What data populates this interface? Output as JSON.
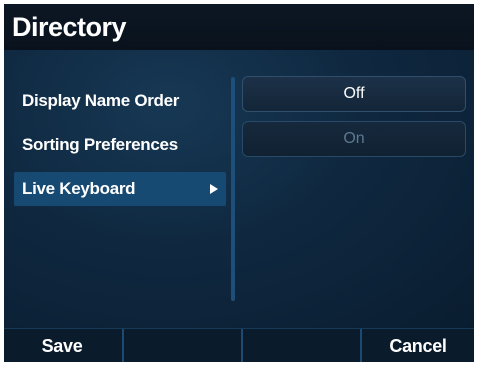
{
  "app": {
    "title": "Directory"
  },
  "menu": {
    "items": [
      {
        "label": "Display Name Order",
        "selected": false
      },
      {
        "label": "Sorting Preferences",
        "selected": false
      },
      {
        "label": "Live Keyboard",
        "selected": true
      }
    ]
  },
  "options": [
    {
      "label": "Off",
      "state": "highlighted"
    },
    {
      "label": "On",
      "state": "dimmed"
    }
  ],
  "softkeys": {
    "left": "Save",
    "slot2": "",
    "slot3": "",
    "right": "Cancel"
  },
  "colors": {
    "screen_bg": "#0b1a2a",
    "selected_item": "#164a73",
    "divider": "#1e4f7a",
    "dim_text": "#5b7891"
  },
  "icons": {
    "submenu": "triangle-right-icon"
  }
}
